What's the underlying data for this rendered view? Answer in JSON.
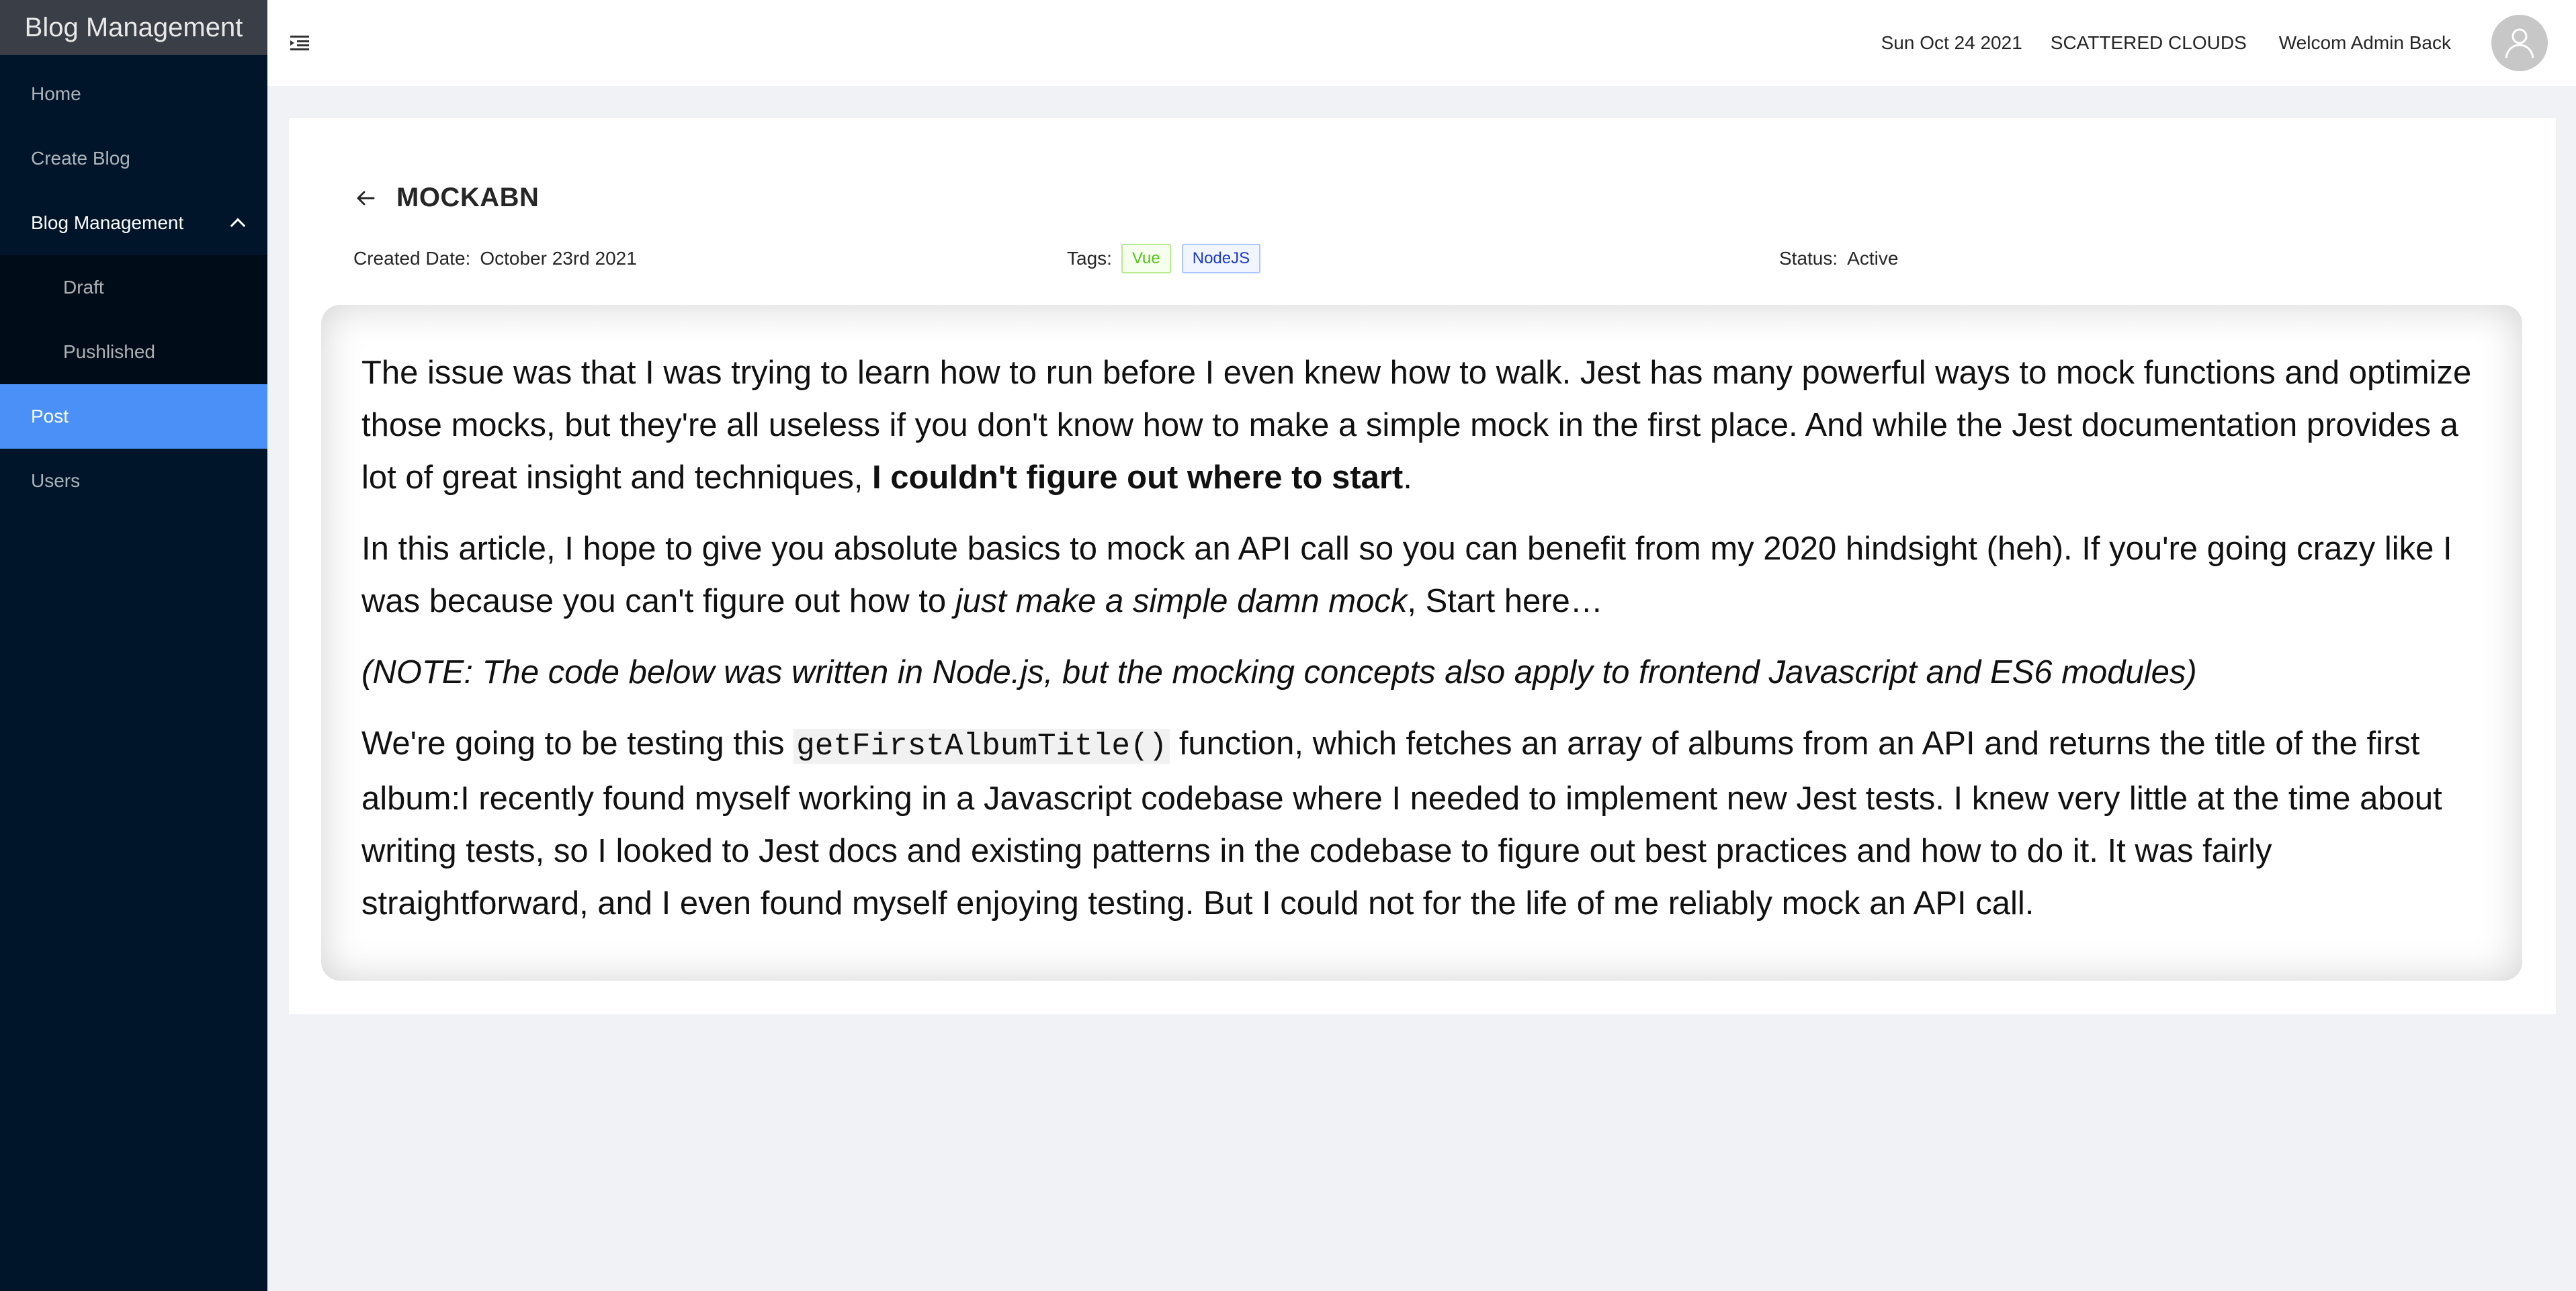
{
  "sidebar": {
    "title": "Blog Management",
    "items": [
      {
        "label": "Home"
      },
      {
        "label": "Create Blog"
      },
      {
        "label": "Blog Management",
        "children": [
          {
            "label": "Draft"
          },
          {
            "label": "Pushlished"
          }
        ]
      },
      {
        "label": "Post"
      },
      {
        "label": "Users"
      }
    ]
  },
  "header": {
    "date": "Sun Oct 24 2021",
    "weather": "SCATTERED CLOUDS",
    "welcome": "Welcom Admin Back"
  },
  "page": {
    "title": "MOCKABN",
    "created_label": "Created Date",
    "created_value": "October 23rd 2021",
    "tags_label": "Tags",
    "tags": [
      "Vue",
      "NodeJS"
    ],
    "status_label": "Status",
    "status_value": "Active"
  },
  "article": {
    "p1_text": "The issue was that I was trying to learn how to run before I even knew how to walk. Jest has many powerful ways to mock functions and optimize those mocks, but they're all useless if you don't know how to make a simple mock in the first place. And while the Jest documentation provides a lot of great insight and techniques, ",
    "p1_bold": "I couldn't figure out where to start",
    "p1_end": ".",
    "p2_text": "In this article, I hope to give you absolute basics to mock an API call so you can benefit from my 2020 hindsight (heh). If you're going crazy like I was because you can't figure out how to ",
    "p2_italic": "just make a simple damn mock",
    "p2_end": ", Start here…",
    "p3_italic": "(NOTE: The code below was written in Node.js, but the mocking concepts also apply to frontend Javascript and ES6 modules)",
    "p4_start": "We're going to be testing this ",
    "p4_code": "getFirstAlbumTitle()",
    "p4_rest": " function, which fetches an array of albums from an API and returns the title of the first album:I recently found myself working in a Javascript codebase where I needed to implement new Jest tests. I knew very little at the time about writing tests, so I looked to Jest docs and existing patterns in the codebase to figure out best practices and how to do it. It was fairly straightforward, and I even found myself enjoying testing. But I could not for the life of me reliably mock an API call."
  },
  "colors": {
    "sidebar_bg": "#001529",
    "active_item": "#4a90f7",
    "submenu_bg": "#000c17",
    "page_bg": "#f0f2f5"
  },
  "icons": [
    "menu-fold-icon",
    "user-avatar-icon",
    "arrow-left-icon",
    "chevron-up-icon"
  ]
}
